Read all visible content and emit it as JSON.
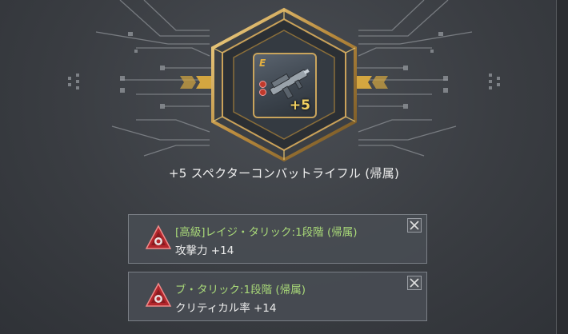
{
  "item": {
    "grade_letter": "E",
    "enhance_badge": "+5",
    "name": "+5 スペクターコンバットライフル (帰属)"
  },
  "options": [
    {
      "title": "[高級]レイジ・タリック:1段階 (帰属)",
      "stat": "攻撃力 +14",
      "gem_icon": "red-tarik-gem-icon",
      "close_icon": "close-icon"
    },
    {
      "title": "ブ・タリック:1段階 (帰属)",
      "stat": "クリティカル率 +14",
      "gem_icon": "red-tarik-gem-icon",
      "close_icon": "close-icon"
    }
  ],
  "colors": {
    "accent_gold": "#c9a45c",
    "option_title_green": "#a8d878",
    "gem_red": "#c0392b"
  }
}
